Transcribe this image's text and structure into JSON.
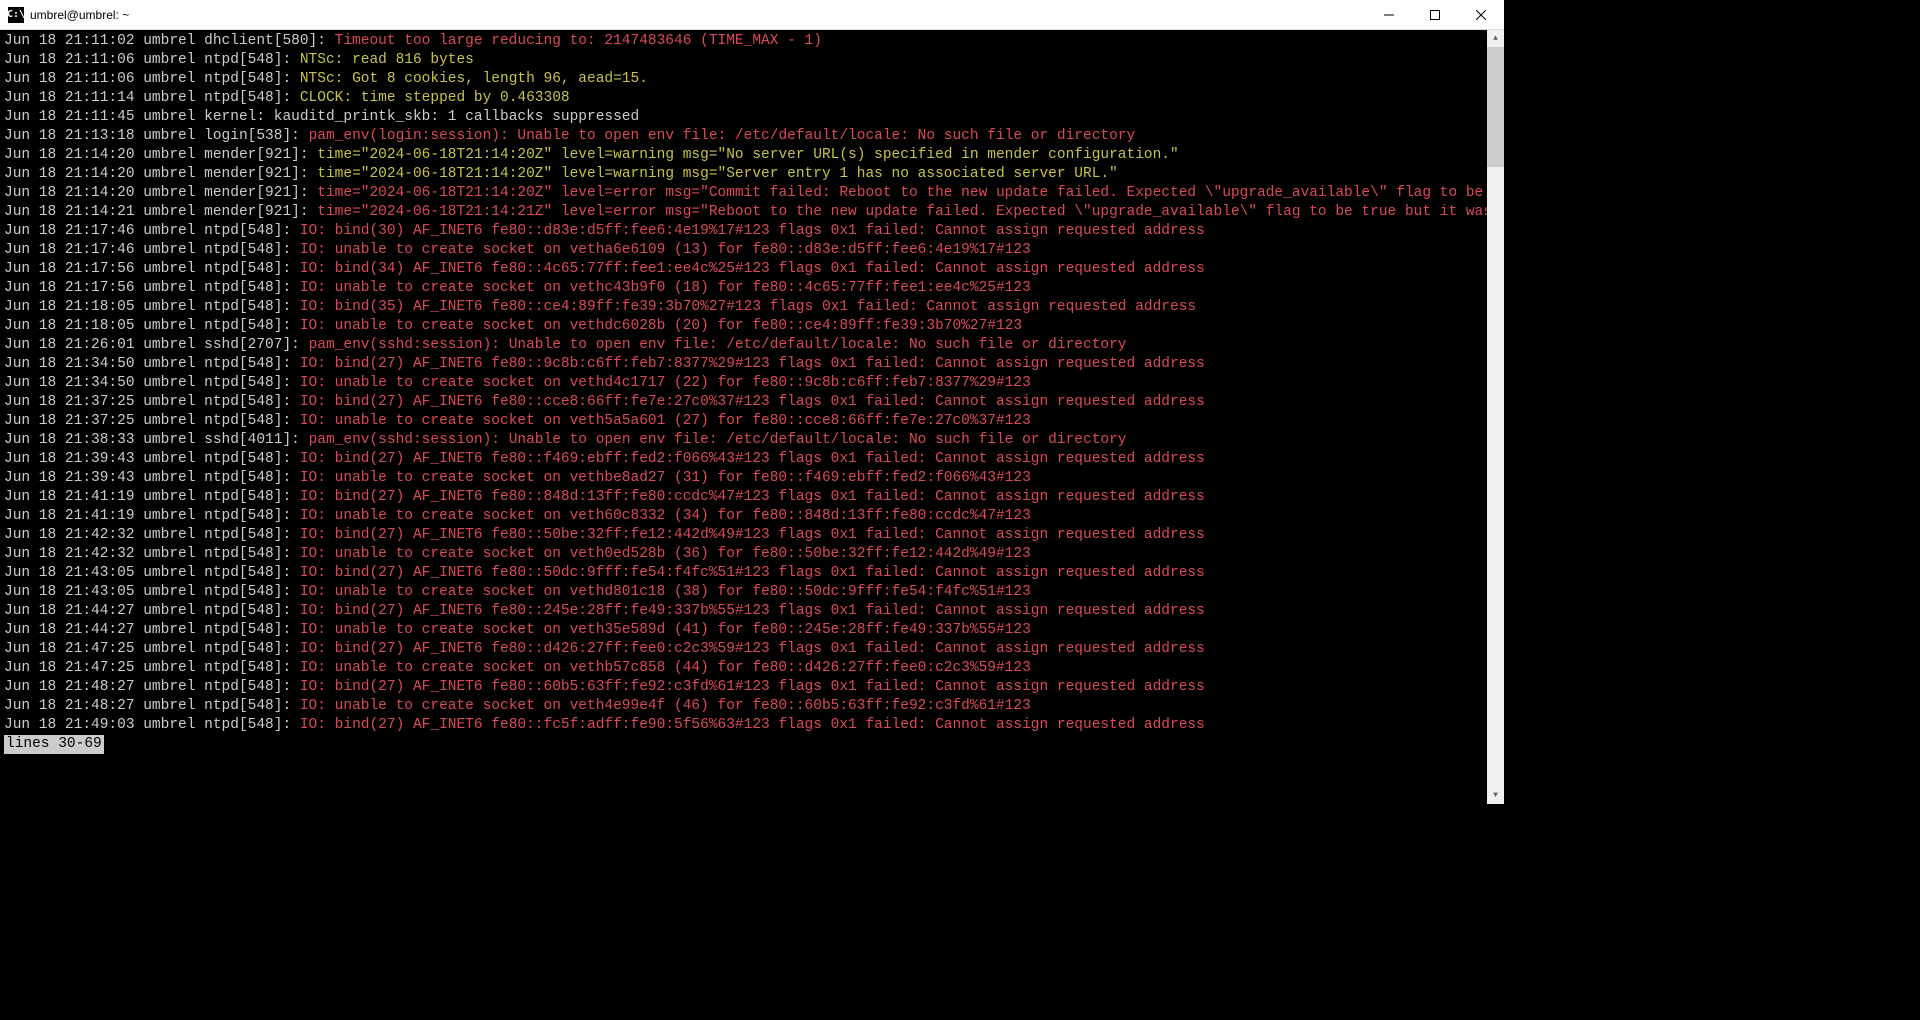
{
  "window": {
    "title": "umbrel@umbrel: ~",
    "icon_label": "C:\\"
  },
  "pager_status": "lines 30-69",
  "log_lines": [
    {
      "prefix": "Jun 18 21:11:02 umbrel dhclient[580]: ",
      "color": "red",
      "msg": "Timeout too large reducing to: 2147483646 (TIME_MAX - 1)"
    },
    {
      "prefix": "Jun 18 21:11:06 umbrel ntpd[548]: ",
      "color": "yellow",
      "msg": "NTSc: read 816 bytes"
    },
    {
      "prefix": "Jun 18 21:11:06 umbrel ntpd[548]: ",
      "color": "yellow",
      "msg": "NTSc: Got 8 cookies, length 96, aead=15."
    },
    {
      "prefix": "Jun 18 21:11:14 umbrel ntpd[548]: ",
      "color": "yellow",
      "msg": "CLOCK: time stepped by 0.463308"
    },
    {
      "prefix": "Jun 18 21:11:45 umbrel kernel: ",
      "color": "default",
      "msg": "kauditd_printk_skb: 1 callbacks suppressed"
    },
    {
      "prefix": "Jun 18 21:13:18 umbrel login[538]: ",
      "color": "red",
      "msg": "pam_env(login:session): Unable to open env file: /etc/default/locale: No such file or directory"
    },
    {
      "prefix": "Jun 18 21:14:20 umbrel mender[921]: ",
      "color": "yellow",
      "msg": "time=\"2024-06-18T21:14:20Z\" level=warning msg=\"No server URL(s) specified in mender configuration.\""
    },
    {
      "prefix": "Jun 18 21:14:20 umbrel mender[921]: ",
      "color": "yellow",
      "msg": "time=\"2024-06-18T21:14:20Z\" level=warning msg=\"Server entry 1 has no associated server URL.\""
    },
    {
      "prefix": "Jun 18 21:14:20 umbrel mender[921]: ",
      "color": "red",
      "msg": "time=\"2024-06-18T21:14:20Z\" level=error msg=\"Commit failed: Reboot to the new update failed. Expected \\\"upgrade_available\\\" flag to be >"
    },
    {
      "prefix": "Jun 18 21:14:21 umbrel mender[921]: ",
      "color": "red",
      "msg": "time=\"2024-06-18T21:14:21Z\" level=error msg=\"Reboot to the new update failed. Expected \\\"upgrade_available\\\" flag to be true but it was>"
    },
    {
      "prefix": "Jun 18 21:17:46 umbrel ntpd[548]: ",
      "color": "red",
      "msg": "IO: bind(30) AF_INET6 fe80::d83e:d5ff:fee6:4e19%17#123 flags 0x1 failed: Cannot assign requested address"
    },
    {
      "prefix": "Jun 18 21:17:46 umbrel ntpd[548]: ",
      "color": "red",
      "msg": "IO: unable to create socket on vetha6e6109 (13) for fe80::d83e:d5ff:fee6:4e19%17#123"
    },
    {
      "prefix": "Jun 18 21:17:56 umbrel ntpd[548]: ",
      "color": "red",
      "msg": "IO: bind(34) AF_INET6 fe80::4c65:77ff:fee1:ee4c%25#123 flags 0x1 failed: Cannot assign requested address"
    },
    {
      "prefix": "Jun 18 21:17:56 umbrel ntpd[548]: ",
      "color": "red",
      "msg": "IO: unable to create socket on vethc43b9f0 (18) for fe80::4c65:77ff:fee1:ee4c%25#123"
    },
    {
      "prefix": "Jun 18 21:18:05 umbrel ntpd[548]: ",
      "color": "red",
      "msg": "IO: bind(35) AF_INET6 fe80::ce4:89ff:fe39:3b70%27#123 flags 0x1 failed: Cannot assign requested address"
    },
    {
      "prefix": "Jun 18 21:18:05 umbrel ntpd[548]: ",
      "color": "red",
      "msg": "IO: unable to create socket on vethdc6028b (20) for fe80::ce4:89ff:fe39:3b70%27#123"
    },
    {
      "prefix": "Jun 18 21:26:01 umbrel sshd[2707]: ",
      "color": "red",
      "msg": "pam_env(sshd:session): Unable to open env file: /etc/default/locale: No such file or directory"
    },
    {
      "prefix": "Jun 18 21:34:50 umbrel ntpd[548]: ",
      "color": "red",
      "msg": "IO: bind(27) AF_INET6 fe80::9c8b:c6ff:feb7:8377%29#123 flags 0x1 failed: Cannot assign requested address"
    },
    {
      "prefix": "Jun 18 21:34:50 umbrel ntpd[548]: ",
      "color": "red",
      "msg": "IO: unable to create socket on vethd4c1717 (22) for fe80::9c8b:c6ff:feb7:8377%29#123"
    },
    {
      "prefix": "Jun 18 21:37:25 umbrel ntpd[548]: ",
      "color": "red",
      "msg": "IO: bind(27) AF_INET6 fe80::cce8:66ff:fe7e:27c0%37#123 flags 0x1 failed: Cannot assign requested address"
    },
    {
      "prefix": "Jun 18 21:37:25 umbrel ntpd[548]: ",
      "color": "red",
      "msg": "IO: unable to create socket on veth5a5a601 (27) for fe80::cce8:66ff:fe7e:27c0%37#123"
    },
    {
      "prefix": "Jun 18 21:38:33 umbrel sshd[4011]: ",
      "color": "red",
      "msg": "pam_env(sshd:session): Unable to open env file: /etc/default/locale: No such file or directory"
    },
    {
      "prefix": "Jun 18 21:39:43 umbrel ntpd[548]: ",
      "color": "red",
      "msg": "IO: bind(27) AF_INET6 fe80::f469:ebff:fed2:f066%43#123 flags 0x1 failed: Cannot assign requested address"
    },
    {
      "prefix": "Jun 18 21:39:43 umbrel ntpd[548]: ",
      "color": "red",
      "msg": "IO: unable to create socket on vethbe8ad27 (31) for fe80::f469:ebff:fed2:f066%43#123"
    },
    {
      "prefix": "Jun 18 21:41:19 umbrel ntpd[548]: ",
      "color": "red",
      "msg": "IO: bind(27) AF_INET6 fe80::848d:13ff:fe80:ccdc%47#123 flags 0x1 failed: Cannot assign requested address"
    },
    {
      "prefix": "Jun 18 21:41:19 umbrel ntpd[548]: ",
      "color": "red",
      "msg": "IO: unable to create socket on veth60c8332 (34) for fe80::848d:13ff:fe80:ccdc%47#123"
    },
    {
      "prefix": "Jun 18 21:42:32 umbrel ntpd[548]: ",
      "color": "red",
      "msg": "IO: bind(27) AF_INET6 fe80::50be:32ff:fe12:442d%49#123 flags 0x1 failed: Cannot assign requested address"
    },
    {
      "prefix": "Jun 18 21:42:32 umbrel ntpd[548]: ",
      "color": "red",
      "msg": "IO: unable to create socket on veth0ed528b (36) for fe80::50be:32ff:fe12:442d%49#123"
    },
    {
      "prefix": "Jun 18 21:43:05 umbrel ntpd[548]: ",
      "color": "red",
      "msg": "IO: bind(27) AF_INET6 fe80::50dc:9fff:fe54:f4fc%51#123 flags 0x1 failed: Cannot assign requested address"
    },
    {
      "prefix": "Jun 18 21:43:05 umbrel ntpd[548]: ",
      "color": "red",
      "msg": "IO: unable to create socket on vethd801c18 (38) for fe80::50dc:9fff:fe54:f4fc%51#123"
    },
    {
      "prefix": "Jun 18 21:44:27 umbrel ntpd[548]: ",
      "color": "red",
      "msg": "IO: bind(27) AF_INET6 fe80::245e:28ff:fe49:337b%55#123 flags 0x1 failed: Cannot assign requested address"
    },
    {
      "prefix": "Jun 18 21:44:27 umbrel ntpd[548]: ",
      "color": "red",
      "msg": "IO: unable to create socket on veth35e589d (41) for fe80::245e:28ff:fe49:337b%55#123"
    },
    {
      "prefix": "Jun 18 21:47:25 umbrel ntpd[548]: ",
      "color": "red",
      "msg": "IO: bind(27) AF_INET6 fe80::d426:27ff:fee0:c2c3%59#123 flags 0x1 failed: Cannot assign requested address"
    },
    {
      "prefix": "Jun 18 21:47:25 umbrel ntpd[548]: ",
      "color": "red",
      "msg": "IO: unable to create socket on vethb57c858 (44) for fe80::d426:27ff:fee0:c2c3%59#123"
    },
    {
      "prefix": "Jun 18 21:48:27 umbrel ntpd[548]: ",
      "color": "red",
      "msg": "IO: bind(27) AF_INET6 fe80::60b5:63ff:fe92:c3fd%61#123 flags 0x1 failed: Cannot assign requested address"
    },
    {
      "prefix": "Jun 18 21:48:27 umbrel ntpd[548]: ",
      "color": "red",
      "msg": "IO: unable to create socket on veth4e99e4f (46) for fe80::60b5:63ff:fe92:c3fd%61#123"
    },
    {
      "prefix": "Jun 18 21:49:03 umbrel ntpd[548]: ",
      "color": "red",
      "msg": "IO: bind(27) AF_INET6 fe80::fc5f:adff:fe90:5f56%63#123 flags 0x1 failed: Cannot assign requested address"
    }
  ]
}
